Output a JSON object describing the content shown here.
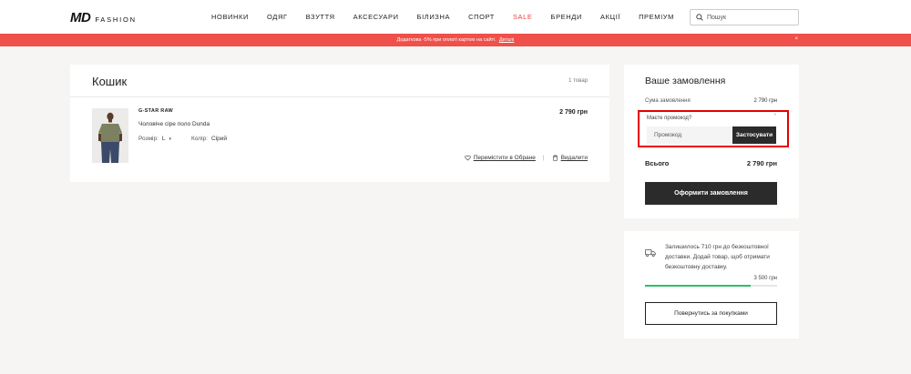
{
  "header": {
    "logo_md": "MD",
    "logo_fashion": "FASHION",
    "nav": [
      "НОВИНКИ",
      "ОДЯГ",
      "ВЗУТТЯ",
      "АКСЕСУАРИ",
      "БІЛИЗНА",
      "СПОРТ",
      "SALE",
      "БРЕНДИ",
      "АКЦІЇ",
      "ПРЕМІУМ"
    ],
    "search_placeholder": "Пошук"
  },
  "promo_bar": {
    "text": "Додаткова -5% при оплаті картою на сайті.",
    "link": "Деталі",
    "close": "×"
  },
  "cart": {
    "title": "Кошик",
    "count": "1 товар",
    "item": {
      "brand": "G-STAR RAW",
      "name": "Чоловіче сіре поло Dunda",
      "size_label": "Розмір:",
      "size_value": "L",
      "color_label": "Колір:",
      "color_value": "Сірий",
      "price": "2 790 грн",
      "move_to_fav": "Перемістити в Обране",
      "separator": "|",
      "delete": "Видалити"
    }
  },
  "summary": {
    "title": "Ваше замовлення",
    "subtotal_label": "Сума замовлення",
    "subtotal_value": "2 790 грн",
    "promo_question": "Маєте промокод?",
    "promo_placeholder": "Промокод",
    "apply": "Застосувати",
    "total_label": "Всього",
    "total_value": "2 790 грн",
    "checkout": "Оформити замовлення"
  },
  "shipping": {
    "text": "Залишилось 710 грн до безкоштовної доставки. Додай товар, щоб отримати безкоштовну доставку.",
    "threshold": "3 500 грн",
    "progress": 0.797,
    "continue": "Повернутись за покупками"
  },
  "colors": {
    "accent_red": "#f0504a",
    "sale_red": "#e8453c",
    "highlight_border": "#e60000",
    "progress_green": "#2dbf6a",
    "button_dark": "#2b2b2b"
  }
}
